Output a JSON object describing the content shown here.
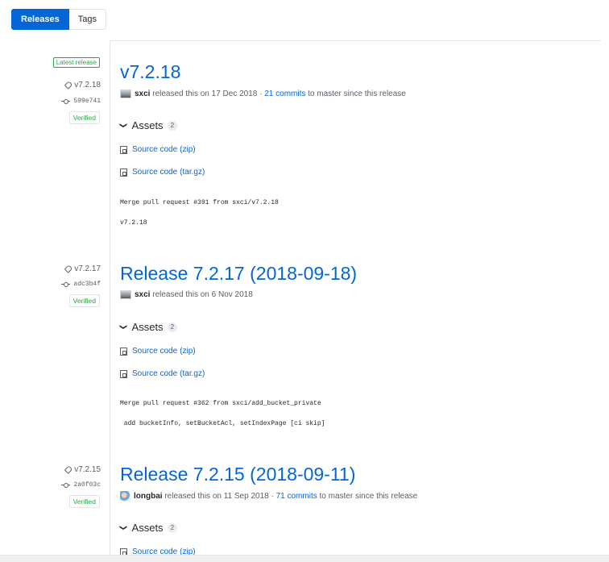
{
  "tabs": [
    {
      "label": "Releases"
    },
    {
      "label": "Tags"
    }
  ],
  "releases": [
    {
      "latest_badge": "Latest release",
      "tag": "v7.2.18",
      "commit": "599e741",
      "verified": "Verified",
      "title": "v7.2.18",
      "author": "sxci",
      "released_text": "released this on 17 Dec 2018 ·",
      "commits_link": "21 commits",
      "commits_suffix": "to master since this release",
      "assets_label": "Assets",
      "assets_count": "2",
      "source_zip": "Source code",
      "source_zip_ext": "(zip)",
      "source_tar": "Source code",
      "source_tar_ext": "(tar.gz)",
      "notes": [
        "Merge pull request #391 from sxci/v7.2.18",
        "v7.2.18"
      ]
    },
    {
      "tag": "v7.2.17",
      "commit": "adc3b4f",
      "verified": "Verified",
      "title": "Release 7.2.17 (2018-09-18)",
      "author": "sxci",
      "released_text": "released this on 6 Nov 2018",
      "assets_label": "Assets",
      "assets_count": "2",
      "source_zip": "Source code",
      "source_zip_ext": "(zip)",
      "source_tar": "Source code",
      "source_tar_ext": "(tar.gz)",
      "notes": [
        "Merge pull request #362 from sxci/add_bucket_private",
        " add bucketInfo, setBucketAcl, setIndexPage [ci skip]"
      ]
    },
    {
      "tag": "v7.2.15",
      "commit": "2a0f03c",
      "verified": "Verified",
      "title": "Release 7.2.15 (2018-09-11)",
      "author": "longbai",
      "released_text": "released this on 11 Sep 2018 ·",
      "commits_link": "71 commits",
      "commits_suffix": "to master since this release",
      "assets_label": "Assets",
      "assets_count": "2",
      "source_zip": "Source code",
      "source_zip_ext": "(zip)"
    }
  ]
}
